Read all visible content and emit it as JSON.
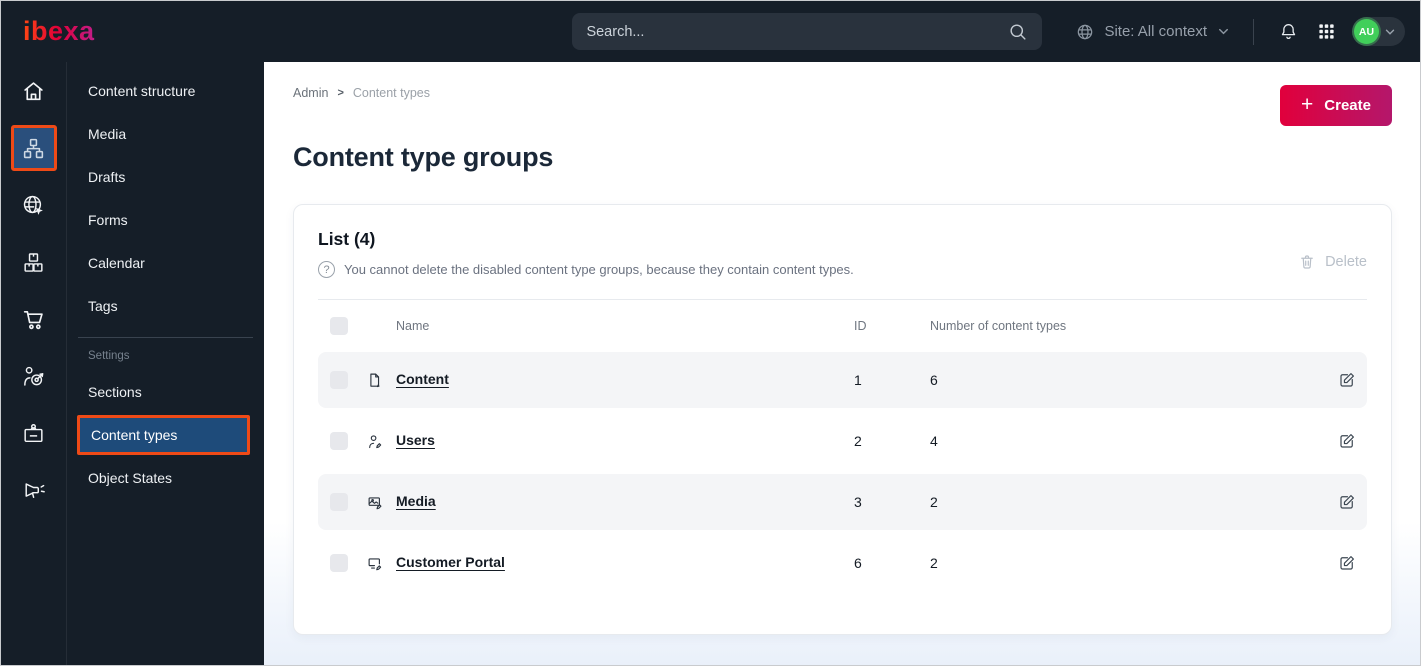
{
  "topbar": {
    "logo": "ibexa",
    "search_placeholder": "Search...",
    "site_context_label": "Site: All context",
    "user_initials": "AU"
  },
  "icon_rail": {
    "items": [
      "home",
      "content-structure",
      "site",
      "product-catalog",
      "commerce",
      "personalization",
      "admin",
      "campaign"
    ],
    "active_index": 1
  },
  "sidebar": {
    "items": [
      {
        "label": "Content structure"
      },
      {
        "label": "Media"
      },
      {
        "label": "Drafts"
      },
      {
        "label": "Forms"
      },
      {
        "label": "Calendar"
      },
      {
        "label": "Tags"
      }
    ],
    "section_label": "Settings",
    "settings_items": [
      {
        "label": "Sections",
        "active": false
      },
      {
        "label": "Content types",
        "active": true
      },
      {
        "label": "Object States",
        "active": false
      }
    ]
  },
  "main": {
    "breadcrumb": [
      "Admin",
      "Content types"
    ],
    "create_label": "Create",
    "page_title": "Content type groups"
  },
  "card": {
    "title": "List (4)",
    "info": "You cannot delete the disabled content type groups, because they contain content types.",
    "delete_label": "Delete",
    "table": {
      "headers": {
        "name": "Name",
        "id": "ID",
        "count": "Number of content types"
      },
      "rows": [
        {
          "icon": "file-icon",
          "name": "Content",
          "id": "1",
          "count": "6"
        },
        {
          "icon": "user-icon",
          "name": "Users",
          "id": "2",
          "count": "4"
        },
        {
          "icon": "image-icon",
          "name": "Media",
          "id": "3",
          "count": "2"
        },
        {
          "icon": "monitor-icon",
          "name": "Customer Portal",
          "id": "6",
          "count": "2"
        }
      ]
    }
  },
  "colors": {
    "topbar_bg": "#151e28",
    "annotation_orange": "#ee4a17",
    "active_item_blue": "#1e4b7a",
    "brand_gradient_start": "#e1003c",
    "brand_gradient_end": "#b4176b",
    "avatar_green": "#41cf5a",
    "row_stripe": "#f4f5f7",
    "text_dark": "#141b24",
    "text_muted": "#6f7680"
  }
}
